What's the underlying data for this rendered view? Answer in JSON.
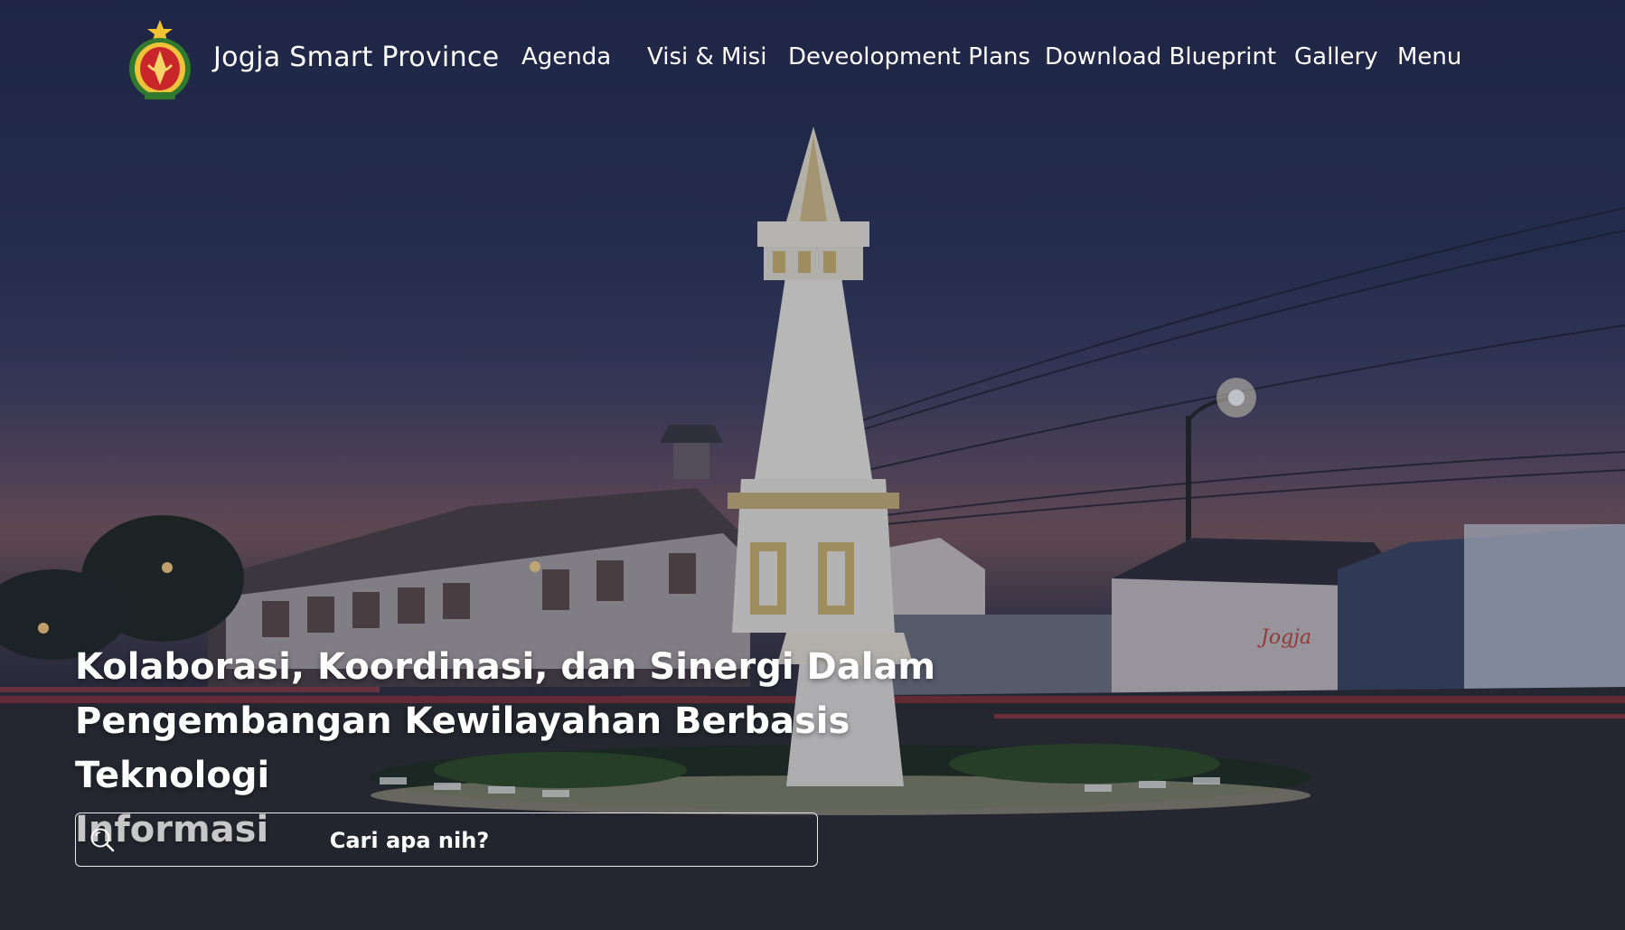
{
  "header": {
    "brand": "Jogja Smart Province",
    "logo_icon": "jogja-coat-of-arms-icon",
    "nav": [
      {
        "label": "Agenda"
      },
      {
        "label": "Visi & Misi"
      },
      {
        "label": "Deveolopment Plans"
      },
      {
        "label": "Download Blueprint"
      },
      {
        "label": "Gallery"
      },
      {
        "label": "Menu"
      }
    ]
  },
  "hero": {
    "line1": "Kolaborasi, Koordinasi, dan Sinergi Dalam",
    "line2": "Pengembangan Kewilayahan Berbasis Teknologi",
    "line3": "Informasi",
    "search": {
      "placeholder": "Cari apa nih?",
      "icon": "search-icon"
    }
  },
  "colors": {
    "sky_top": "#27305a",
    "sky_horizon": "#9a6a66",
    "text": "#ffffff"
  }
}
